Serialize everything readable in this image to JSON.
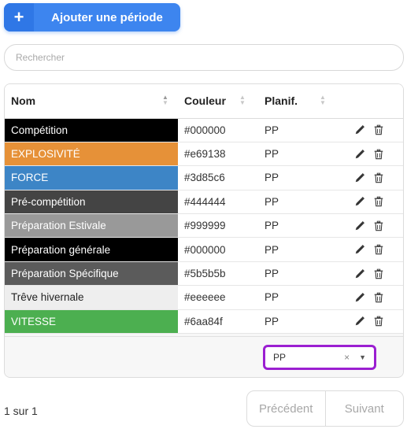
{
  "toolbar": {
    "add_icon": "+",
    "add_label": "Ajouter une période"
  },
  "search": {
    "placeholder": "Rechercher",
    "value": ""
  },
  "table": {
    "headers": {
      "nom": "Nom",
      "couleur": "Couleur",
      "planif": "Planif."
    },
    "rows": [
      {
        "nom": "Compétition",
        "couleur": "#000000",
        "planif": "PP",
        "bg": "#000000",
        "fg": "#ffffff"
      },
      {
        "nom": "EXPLOSIVITÉ",
        "couleur": "#e69138",
        "planif": "PP",
        "bg": "#e69138",
        "fg": "#ffffff"
      },
      {
        "nom": "FORCE",
        "couleur": "#3d85c6",
        "planif": "PP",
        "bg": "#3d85c6",
        "fg": "#ffffff"
      },
      {
        "nom": "Pré-compétition",
        "couleur": "#444444",
        "planif": "PP",
        "bg": "#444444",
        "fg": "#ffffff"
      },
      {
        "nom": "Préparation Estivale",
        "couleur": "#999999",
        "planif": "PP",
        "bg": "#999999",
        "fg": "#ffffff"
      },
      {
        "nom": "Préparation générale",
        "couleur": "#000000",
        "planif": "PP",
        "bg": "#000000",
        "fg": "#ffffff"
      },
      {
        "nom": "Préparation Spécifique",
        "couleur": "#5b5b5b",
        "planif": "PP",
        "bg": "#5b5b5b",
        "fg": "#ffffff"
      },
      {
        "nom": "Trêve hivernale",
        "couleur": "#eeeeee",
        "planif": "PP",
        "bg": "#eeeeee",
        "fg": "#222222"
      },
      {
        "nom": "VITESSE",
        "couleur": "#6aa84f",
        "planif": "PP",
        "bg": "#4caf50",
        "fg": "#ffffff"
      }
    ],
    "row_actions": [
      "pencil-icon",
      "trash-icon"
    ]
  },
  "filter": {
    "value": "PP",
    "clear": "×",
    "caret": "▼",
    "highlight_color": "#9b1fd1"
  },
  "pagination": {
    "status": "1 sur 1",
    "prev": "Précédent",
    "next": "Suivant"
  },
  "colors": {
    "accent": "#3d85ef"
  }
}
